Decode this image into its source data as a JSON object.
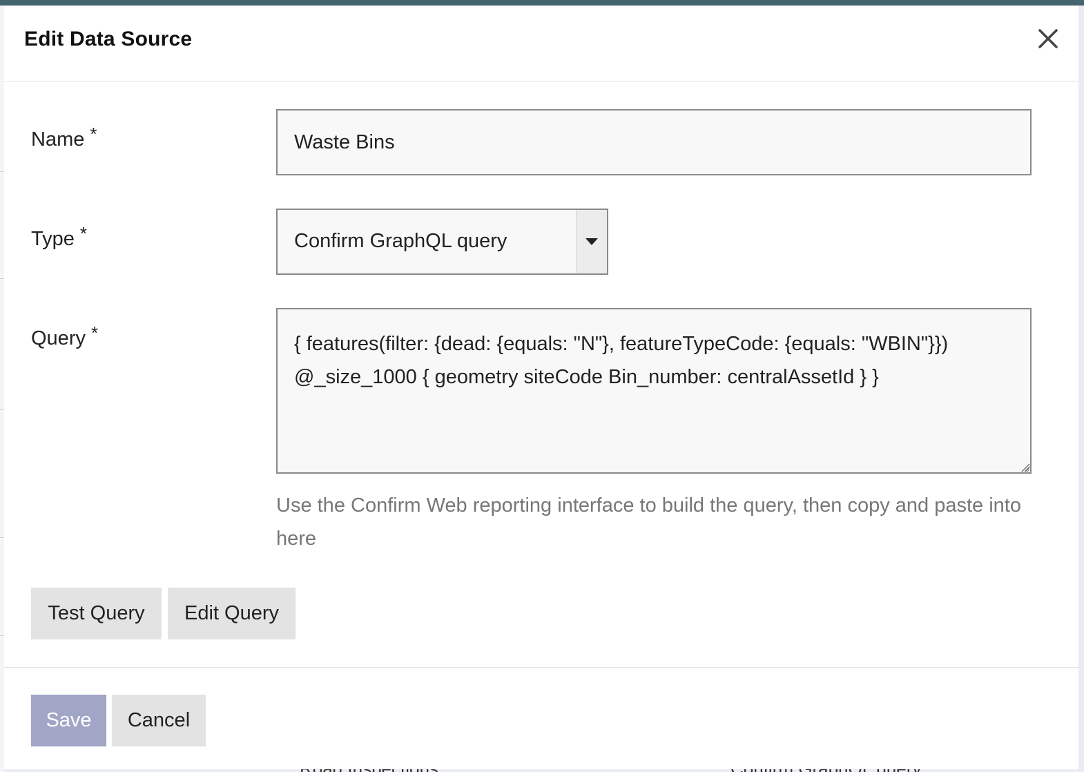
{
  "background": {
    "row_left": "Road Inspections",
    "row_right": "Confirm GraphQL query"
  },
  "modal": {
    "title": "Edit Data Source",
    "close_icon": "close-icon",
    "fields": {
      "name": {
        "label": "Name",
        "required": "*",
        "value": "Waste Bins"
      },
      "type": {
        "label": "Type",
        "required": "*",
        "value": "Confirm GraphQL query",
        "icon": "chevron-down-icon"
      },
      "query": {
        "label": "Query",
        "required": "*",
        "value": "{ features(filter: {dead: {equals: \"N\"}, featureTypeCode: {equals: \"WBIN\"}}) @_size_1000 { geometry siteCode Bin_number: centralAssetId } }",
        "help": "Use the Confirm Web reporting interface to build the query, then copy and paste into here"
      }
    },
    "buttons": {
      "test_query": "Test Query",
      "edit_query": "Edit Query",
      "save": "Save",
      "cancel": "Cancel"
    }
  },
  "colors": {
    "topbar": "#44646f",
    "save_button": "#a1a5c6",
    "secondary_button": "#e3e3e3",
    "input_border": "#8a8a8a"
  }
}
